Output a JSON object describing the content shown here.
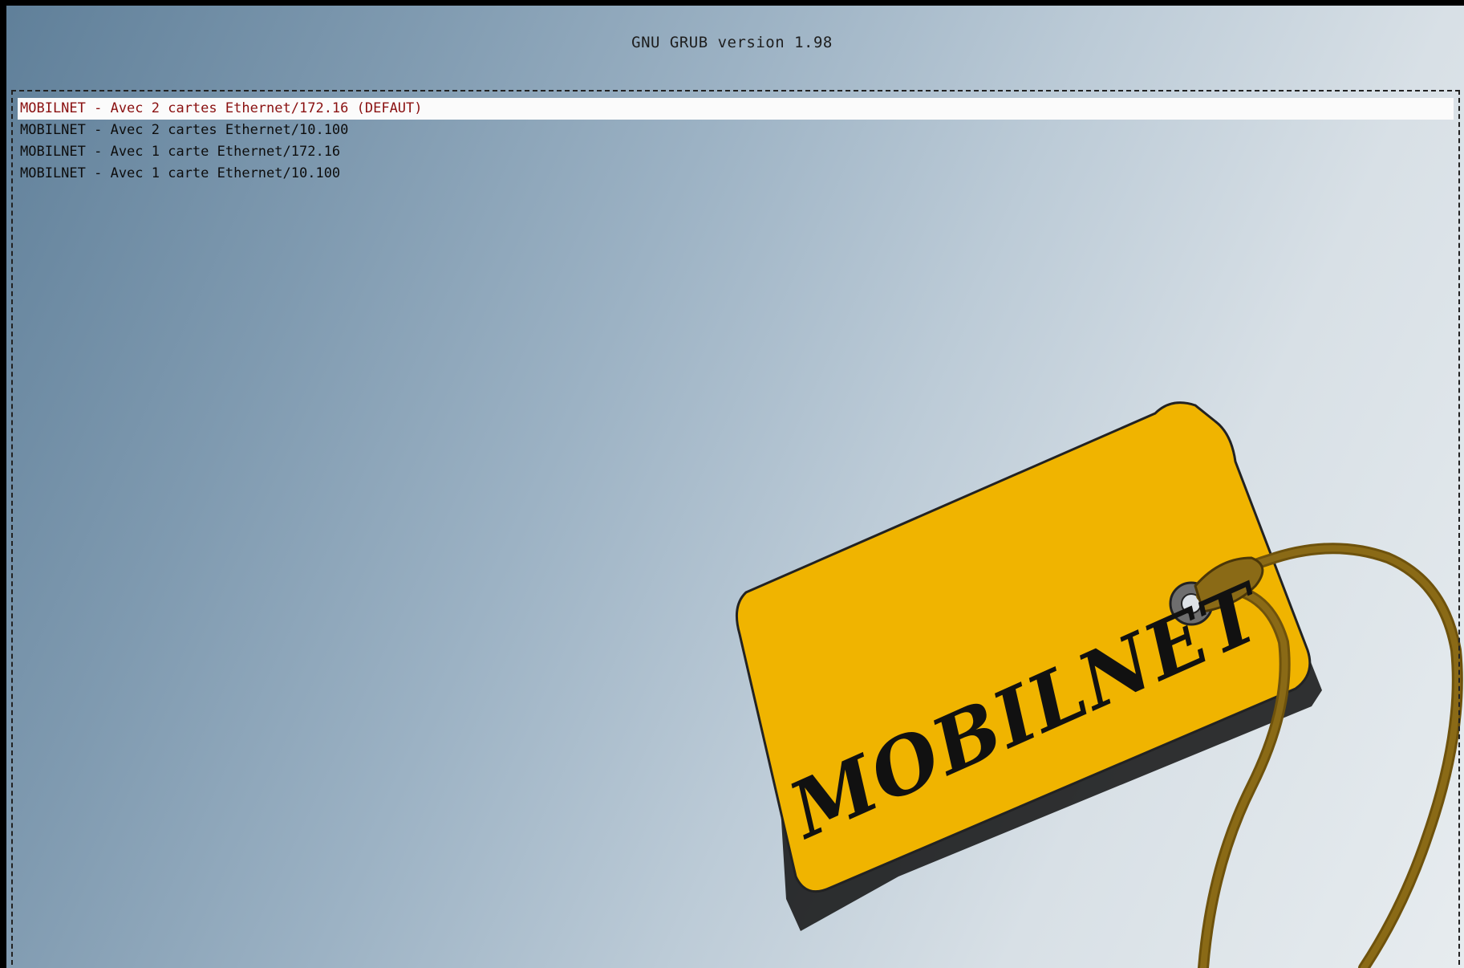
{
  "header": {
    "title": "GNU GRUB  version 1.98"
  },
  "menu": {
    "entries": [
      {
        "label": "MOBILNET - Avec 2 cartes Ethernet/172.16 (DEFAUT)",
        "selected": true
      },
      {
        "label": "MOBILNET - Avec 2 cartes Ethernet/10.100",
        "selected": false
      },
      {
        "label": "MOBILNET - Avec 1 carte Ethernet/172.16",
        "selected": false
      },
      {
        "label": "MOBILNET - Avec 1 carte Ethernet/10.100",
        "selected": false
      }
    ]
  },
  "background": {
    "logo_text": "MOBILNET",
    "logo_icon": "luggage-tag-icon"
  },
  "colors": {
    "selected_text": "#8a1010",
    "highlight_bg": "#fbfbfb",
    "tag_yellow": "#f0b400",
    "string_brown": "#7a5a10"
  }
}
